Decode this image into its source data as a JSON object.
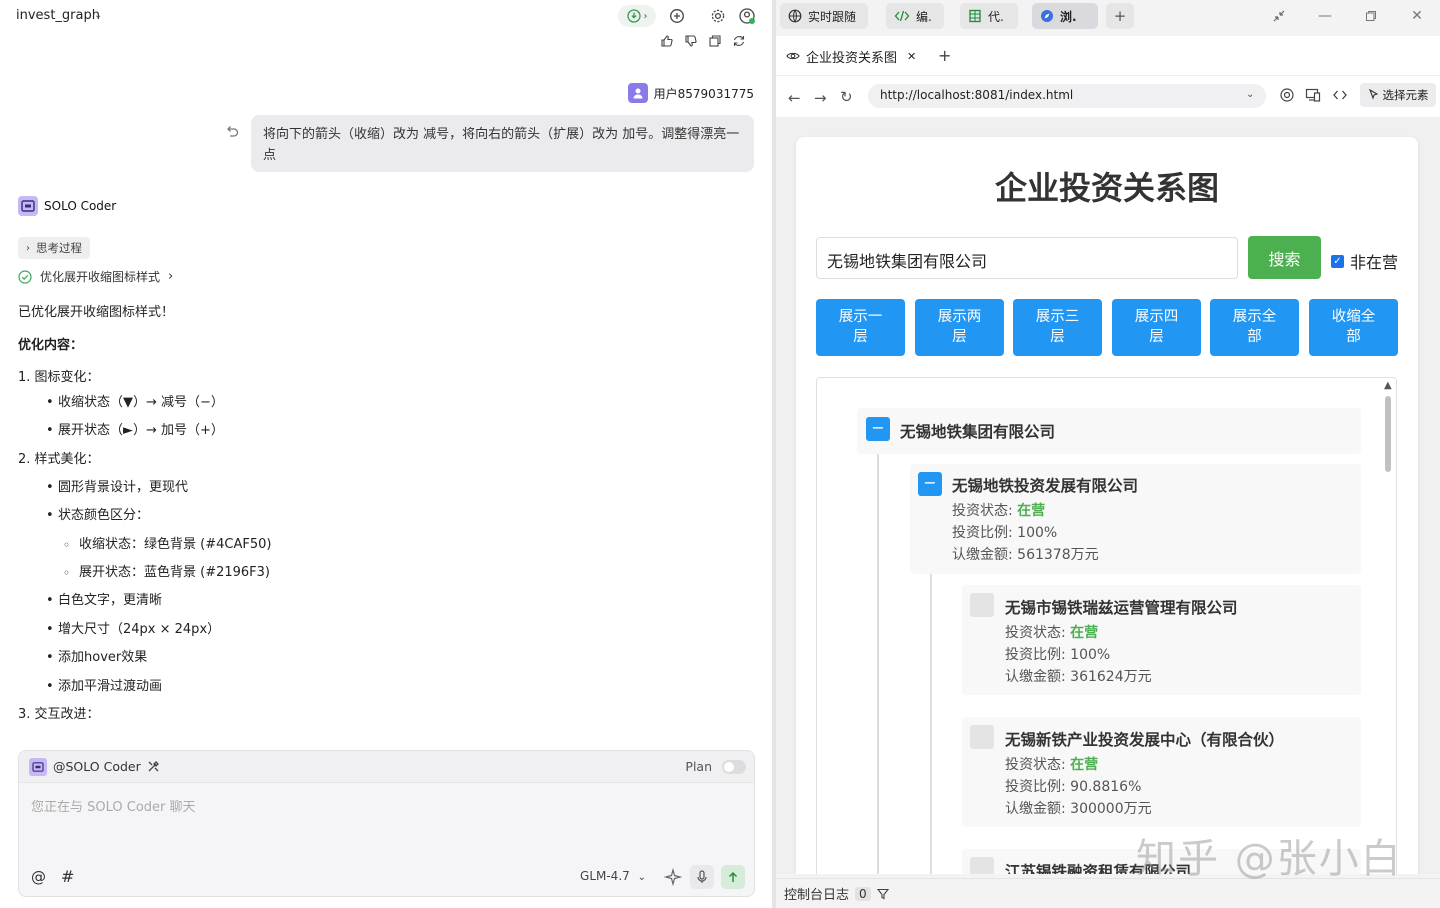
{
  "left": {
    "project_title": "invest_graph",
    "user": {
      "name": "用户8579031775",
      "message": "将向下的箭头（收缩）改为 减号，将向右的箭头（扩展）改为 加号。调整得漂亮一点"
    },
    "bot": {
      "name": "SOLO Coder",
      "thinking_label": "思考过程",
      "step_label": "优化展开收缩图标样式"
    },
    "answer": {
      "intro": "已优化展开收缩图标样式！",
      "heading": "优化内容：",
      "s1": "1. 图标变化：",
      "s1_a": "收缩状态（▼）→ 减号（−）",
      "s1_b": "展开状态（►）→ 加号（+）",
      "s2": "2. 样式美化：",
      "s2_a": "圆形背景设计，更现代",
      "s2_b": "状态颜色区分：",
      "s2_b1": "收缩状态：绿色背景 (#4CAF50)",
      "s2_b2": "展开状态：蓝色背景 (#2196F3)",
      "s2_c": "白色文字，更清晰",
      "s2_d": "增大尺寸（24px × 24px）",
      "s2_e": "添加hover效果",
      "s2_f": "添加平滑过渡动画",
      "s3": "3. 交互改进："
    },
    "composer": {
      "agent": "@SOLO Coder",
      "plan_label": "Plan",
      "placeholder": "您正在与 SOLO Coder 聊天",
      "at": "@",
      "hash": "#",
      "model": "GLM-4.7"
    }
  },
  "right": {
    "tabs": [
      {
        "label": "实时跟随",
        "icon": "globe-icon"
      },
      {
        "label": "编.",
        "icon": "code-icon"
      },
      {
        "label": "代.",
        "icon": "book-icon"
      },
      {
        "label": "浏.",
        "icon": "compass-icon"
      }
    ],
    "browser_tab": "企业投资关系图",
    "url": "http://localhost:8081/index.html",
    "pick_element": "选择元素",
    "console_label": "控制台日志",
    "console_count": "0"
  },
  "page": {
    "heading": "企业投资关系图",
    "search_value": "无锡地铁集团有限公司",
    "search_button": "搜索",
    "inactive_label": "非在营",
    "level_buttons": [
      "展示一层",
      "展示两层",
      "展示三层",
      "展示四层",
      "展示全部",
      "收缩全部"
    ],
    "labels": {
      "status": "投资状态: ",
      "ratio": "投资比例: ",
      "amount": "认缴金额: "
    },
    "tree": {
      "root": "无锡地铁集团有限公司",
      "n1": {
        "name": "无锡地铁投资发展有限公司",
        "status": "在营",
        "ratio": "100%",
        "amount": "561378万元"
      },
      "n2": {
        "name": "无锡市锡铁瑞兹运营管理有限公司",
        "status": "在营",
        "ratio": "100%",
        "amount": "361624万元"
      },
      "n3": {
        "name": "无锡新铁产业投资发展中心（有限合伙）",
        "status": "在营",
        "ratio": "90.8816%",
        "amount": "300000万元"
      },
      "n4": {
        "name": "江苏锡铁融资租赁有限公司"
      }
    },
    "collapse_symbol": "−"
  },
  "watermark": "知乎 @张小白"
}
